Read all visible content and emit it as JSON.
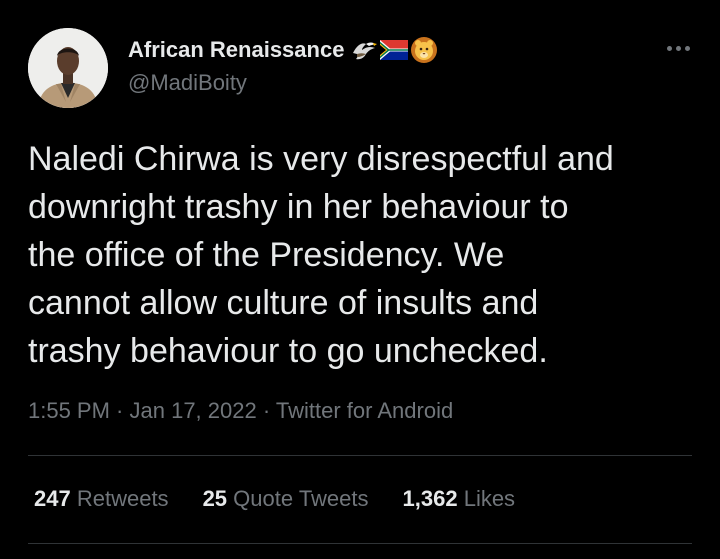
{
  "author": {
    "display_name": "African Renaissance",
    "handle": "@MadiBoity",
    "avatar": "person-avatar",
    "name_emojis": [
      "eagle-emoji",
      "south-africa-flag-emoji",
      "lion-face-emoji"
    ]
  },
  "more_icon": "more-dots-icon",
  "tweet": {
    "lines": [
      "Naledi Chirwa is very disrespectful and",
      "downright trashy in her behaviour to",
      "the office of the Presidency. We",
      "cannot allow culture of insults and",
      "trashy behaviour to go unchecked."
    ]
  },
  "meta": {
    "time": "1:55 PM",
    "date": "Jan 17, 2022",
    "source": "Twitter for Android",
    "separator": " · "
  },
  "stats": [
    {
      "count": "247",
      "label": "Retweets"
    },
    {
      "count": "25",
      "label": "Quote Tweets"
    },
    {
      "count": "1,362",
      "label": "Likes"
    }
  ],
  "colors": {
    "background": "#000000",
    "primary_text": "#e7e9ea",
    "secondary_text": "#71767b",
    "divider": "#2f3336"
  }
}
